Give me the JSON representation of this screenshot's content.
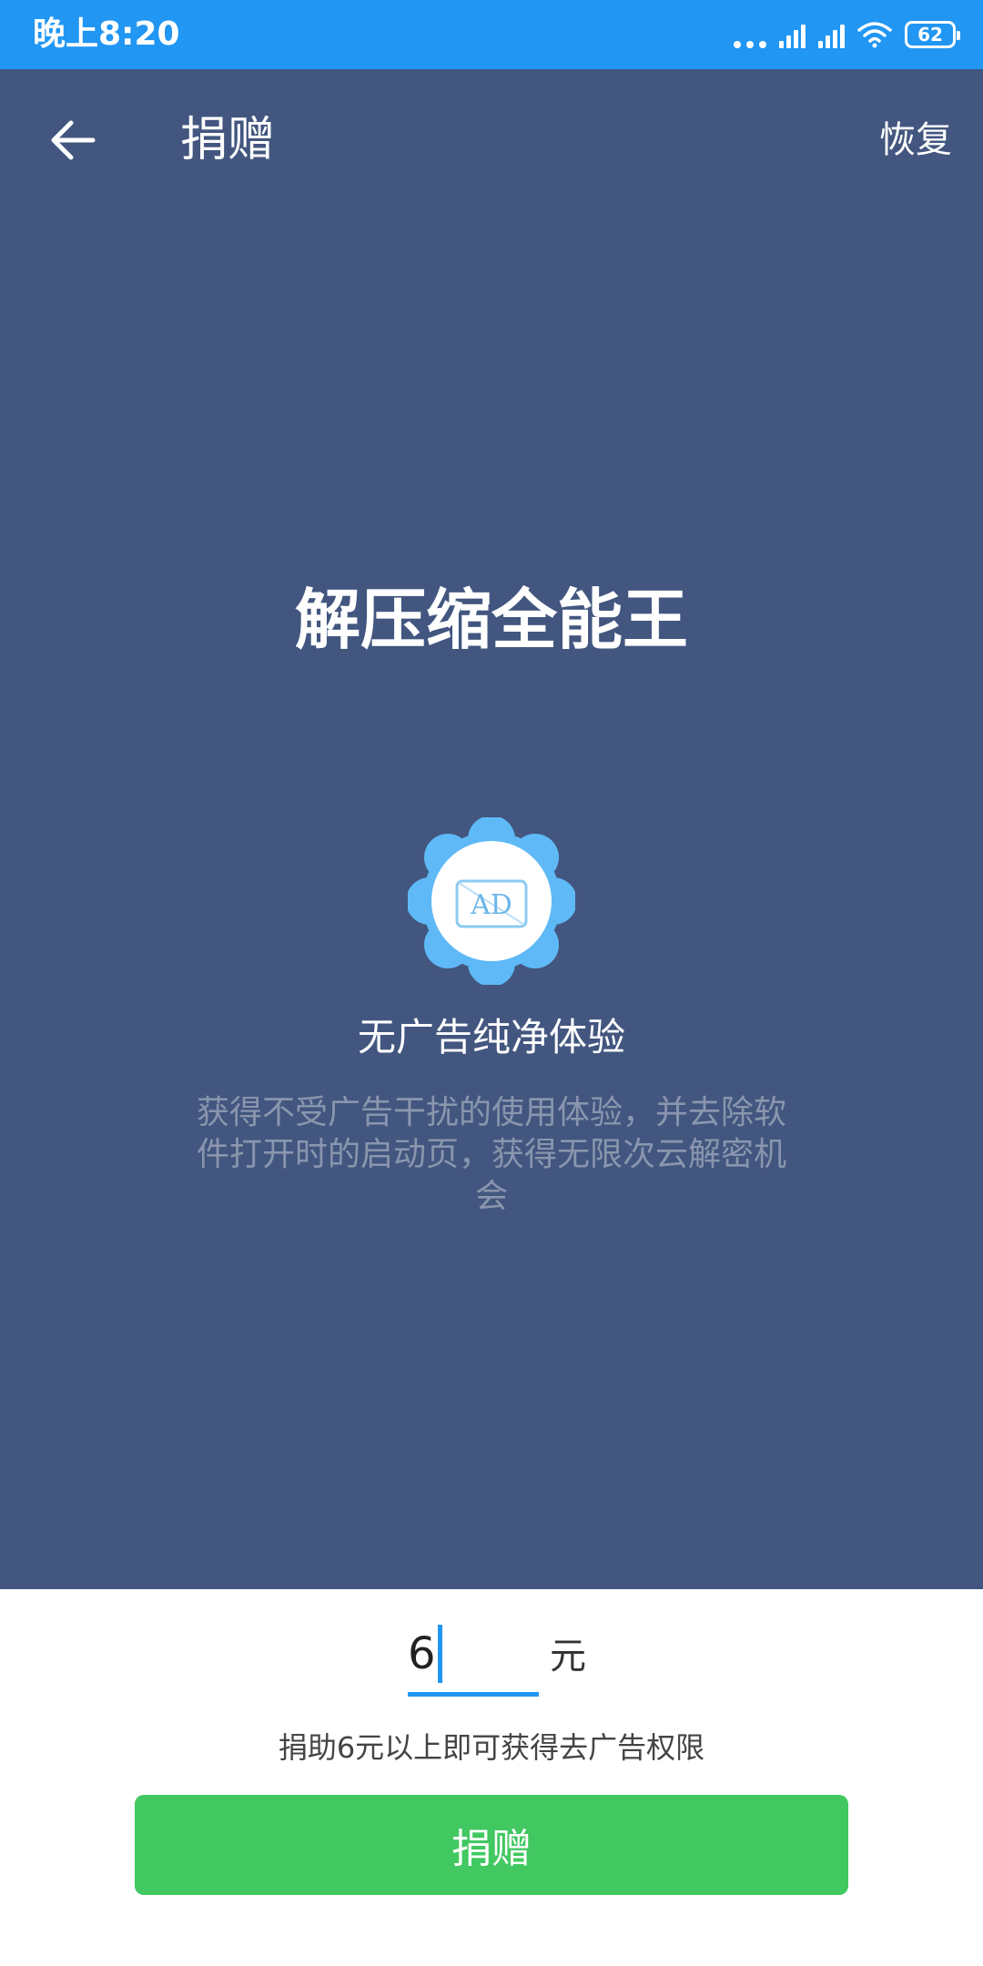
{
  "status_bar": {
    "time": "晚上8:20",
    "battery": "62",
    "icons": [
      "more-dots-icon",
      "signal-icon",
      "signal-icon",
      "wifi-icon",
      "battery-icon"
    ]
  },
  "header": {
    "back_icon": "arrow-left-icon",
    "title": "捐赠",
    "restore_label": "恢复"
  },
  "hero": {
    "app_name": "解压缩全能王",
    "badge_icon": "ad-badge-icon",
    "badge_text": "AD",
    "feature_title": "无广告纯净体验",
    "feature_desc": "获得不受广告干扰的使用体验，并去除软件打开时的启动页，获得无限次云解密机会"
  },
  "donate": {
    "amount_value": "6",
    "unit": "元",
    "hint": "捐助6元以上即可获得去广告权限",
    "button_label": "捐赠"
  },
  "colors": {
    "status_bar": "#2196F3",
    "hero_bg": "#42567F",
    "accent": "#2196F3",
    "button": "#41C861",
    "desc_text": "#8A96AE"
  }
}
